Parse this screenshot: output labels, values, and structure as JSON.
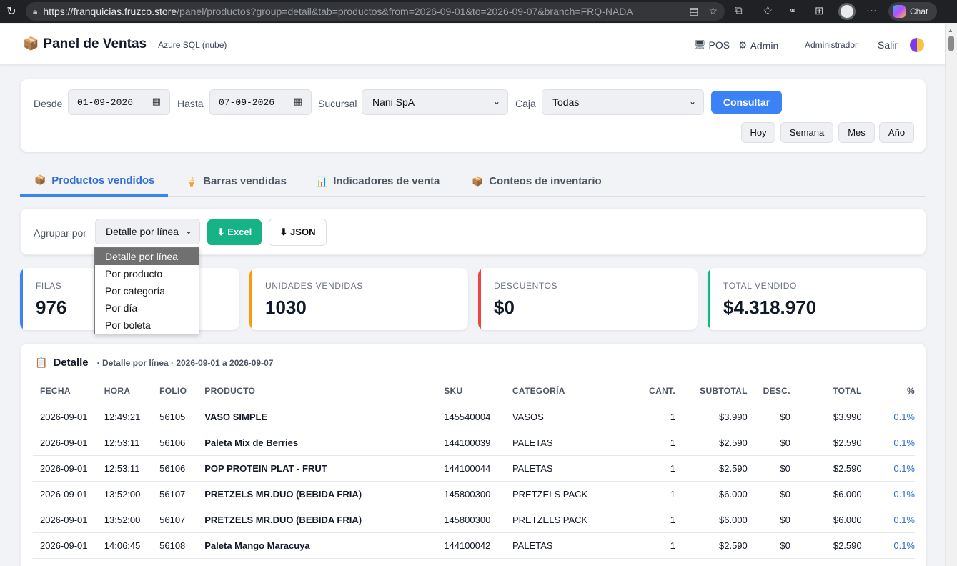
{
  "browser": {
    "url_host": "https://franquicias.fruzco.store",
    "url_path": "/panel/productos?group=detail&tab=productos&from=2026-09-01&to=2026-09-07&branch=FRQ-NADA",
    "chat_label": "Chat"
  },
  "header": {
    "title": "Panel de Ventas",
    "subtitle": "Azure SQL (nube)",
    "pos_label": "POS",
    "admin_label": "Admin",
    "user_label": "Administrador",
    "logout_label": "Salir"
  },
  "filters": {
    "from_label": "Desde",
    "from_value": "01-09-2026",
    "to_label": "Hasta",
    "to_value": "07-09-2026",
    "branch_label": "Sucursal",
    "branch_value": "Nani SpA",
    "register_label": "Caja",
    "register_value": "Todas",
    "submit_label": "Consultar",
    "quick": [
      "Hoy",
      "Semana",
      "Mes",
      "Año"
    ]
  },
  "tabs": [
    {
      "label": "Productos vendidos",
      "icon": "box-icon"
    },
    {
      "label": "Barras vendidas",
      "icon": "icecream-icon"
    },
    {
      "label": "Indicadores de venta",
      "icon": "chart-icon"
    },
    {
      "label": "Conteos de inventario",
      "icon": "box-icon"
    }
  ],
  "group": {
    "label": "Agrupar por",
    "value": "Detalle por línea",
    "options": [
      "Detalle por línea",
      "Por producto",
      "Por categoría",
      "Por día",
      "Por boleta"
    ],
    "excel_label": "⬇ Excel",
    "json_label": "⬇ JSON"
  },
  "stats": [
    {
      "label": "FILAS",
      "value": "976",
      "color": "#3b82f6"
    },
    {
      "label": "UNIDADES VENDIDAS",
      "value": "1030",
      "color": "#f59e0b"
    },
    {
      "label": "DESCUENTOS",
      "value": "$0",
      "color": "#ef4444"
    },
    {
      "label": "TOTAL VENDIDO",
      "value": "$4.318.970",
      "color": "#10b981"
    }
  ],
  "detail": {
    "title": "Detalle",
    "subtitle": "· Detalle por línea · 2026-09-01 a 2026-09-07",
    "columns": [
      "FECHA",
      "HORA",
      "FOLIO",
      "PRODUCTO",
      "SKU",
      "CATEGORÍA",
      "CANT.",
      "SUBTOTAL",
      "DESC.",
      "TOTAL",
      "%"
    ],
    "rows": [
      [
        "2026-09-01",
        "12:49:21",
        "56105",
        "VASO SIMPLE",
        "145540004",
        "VASOS",
        "1",
        "$3.990",
        "$0",
        "$3.990",
        "0.1%"
      ],
      [
        "2026-09-01",
        "12:53:11",
        "56106",
        "Paleta Mix de Berries",
        "144100039",
        "PALETAS",
        "1",
        "$2.590",
        "$0",
        "$2.590",
        "0.1%"
      ],
      [
        "2026-09-01",
        "12:53:11",
        "56106",
        "POP PROTEIN PLAT - FRUT",
        "144100044",
        "PALETAS",
        "1",
        "$2.590",
        "$0",
        "$2.590",
        "0.1%"
      ],
      [
        "2026-09-01",
        "13:52:00",
        "56107",
        "PRETZELS MR.DUO (BEBIDA FRIA)",
        "145800300",
        "PRETZELS PACK",
        "1",
        "$6.000",
        "$0",
        "$6.000",
        "0.1%"
      ],
      [
        "2026-09-01",
        "13:52:00",
        "56107",
        "PRETZELS MR.DUO (BEBIDA FRIA)",
        "145800300",
        "PRETZELS PACK",
        "1",
        "$6.000",
        "$0",
        "$6.000",
        "0.1%"
      ],
      [
        "2026-09-01",
        "14:06:45",
        "56108",
        "Paleta Mango Maracuya",
        "144100042",
        "PALETAS",
        "1",
        "$2.590",
        "$0",
        "$2.590",
        "0.1%"
      ]
    ]
  }
}
